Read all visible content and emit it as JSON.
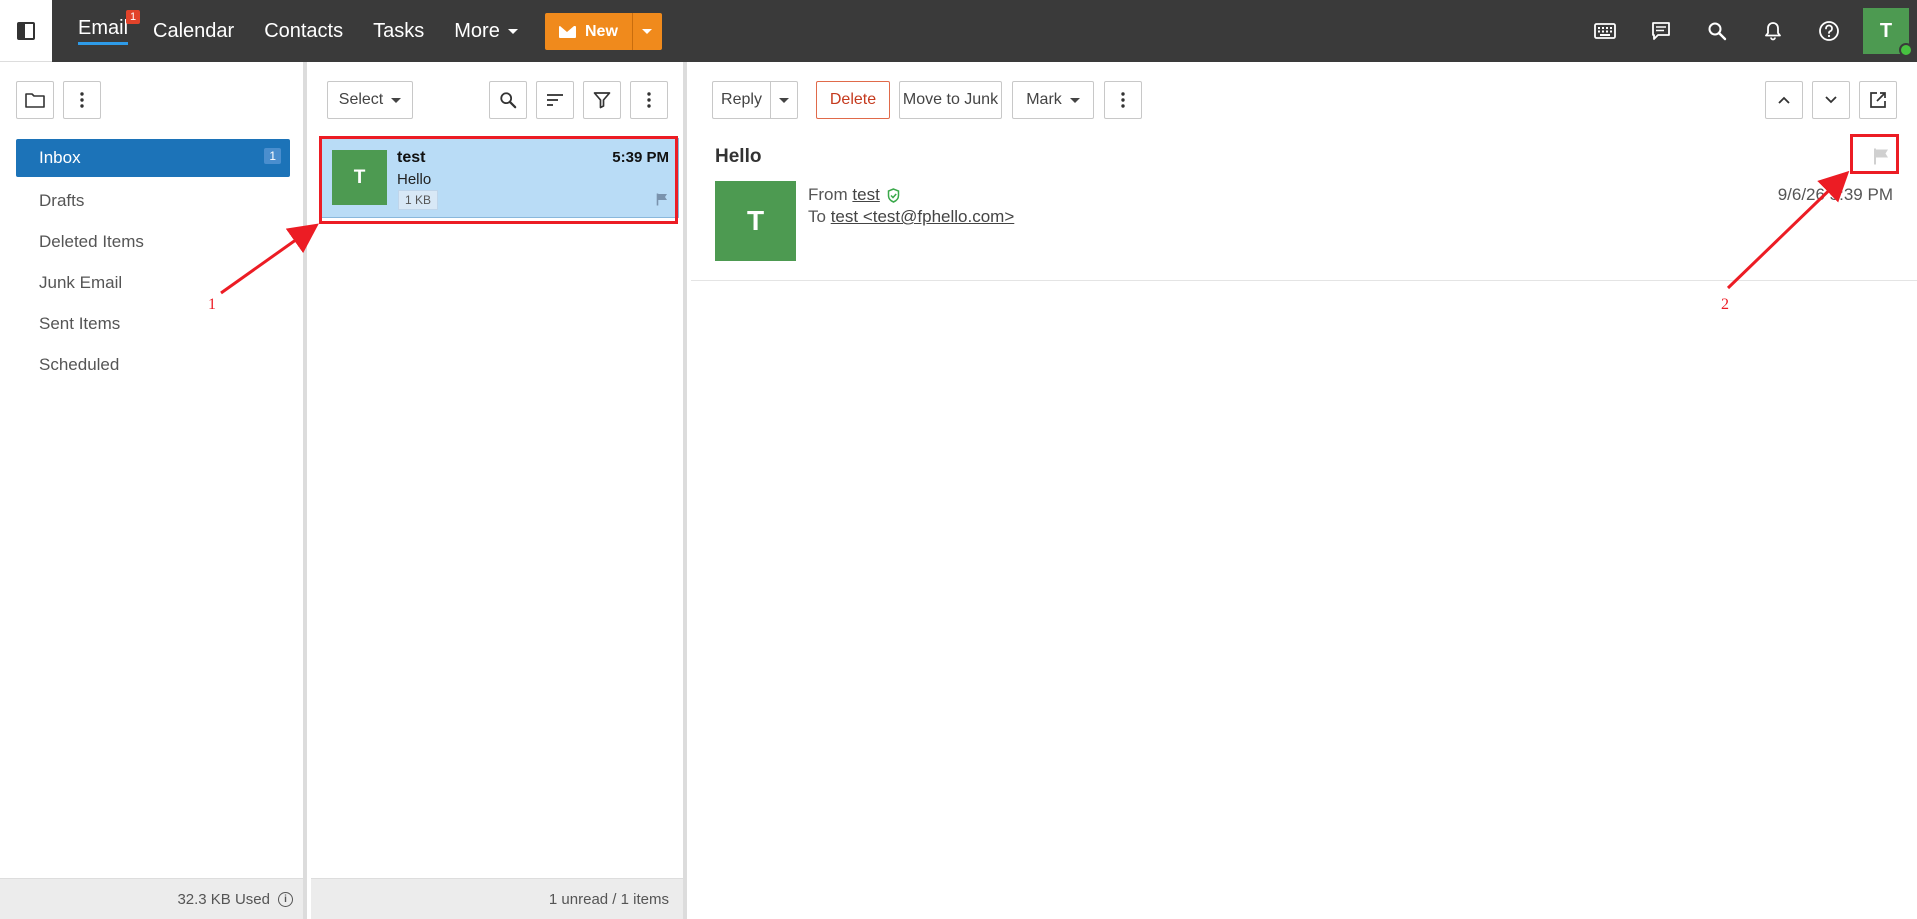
{
  "topbar": {
    "nav": [
      {
        "label": "Email",
        "badge": "1"
      },
      {
        "label": "Calendar"
      },
      {
        "label": "Contacts"
      },
      {
        "label": "Tasks"
      },
      {
        "label": "More"
      }
    ],
    "new_label": "New",
    "avatar_initial": "T",
    "icons": [
      "keyboard-icon",
      "chat-icon",
      "search-icon",
      "bell-icon",
      "help-icon"
    ]
  },
  "folders": {
    "items": [
      {
        "label": "Inbox",
        "count": "1"
      },
      {
        "label": "Drafts"
      },
      {
        "label": "Deleted Items"
      },
      {
        "label": "Junk Email"
      },
      {
        "label": "Sent Items"
      },
      {
        "label": "Scheduled"
      }
    ],
    "quota": "32.3 KB Used"
  },
  "list": {
    "select_label": "Select",
    "message": {
      "initial": "T",
      "from": "test",
      "time": "5:39 PM",
      "subject": "Hello",
      "size": "1 KB"
    },
    "status": "1 unread / 1 items"
  },
  "reader": {
    "reply_label": "Reply",
    "delete_label": "Delete",
    "junk_label": "Move to Junk",
    "mark_label": "Mark",
    "subject": "Hello",
    "avatar_initial": "T",
    "from_prefix": "From",
    "from_name": "test",
    "to_prefix": "To",
    "to_address": "test <test@fphello.com>",
    "date": "9/6/26 5:39 PM"
  },
  "annotations": {
    "label_1": "1",
    "label_2": "2"
  },
  "colors": {
    "accent": "#1c73b8",
    "new_button": "#f08a1c",
    "avatar": "#4d9a51",
    "annotation": "#ec1c24"
  }
}
